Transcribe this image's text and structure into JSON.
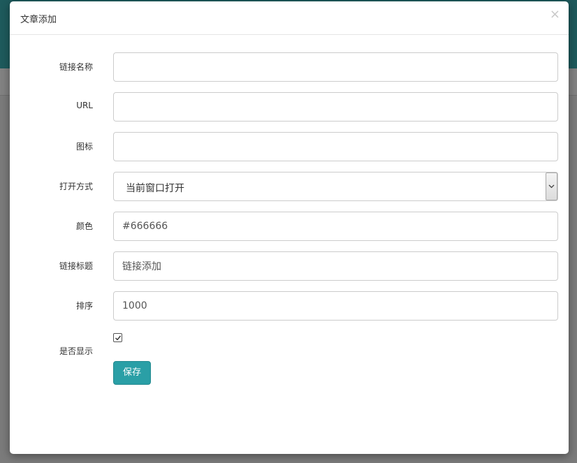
{
  "modal": {
    "title": "文章添加",
    "close_glyph": "×"
  },
  "form": {
    "link_name": {
      "label": "链接名称",
      "value": ""
    },
    "url": {
      "label": "URL",
      "value": ""
    },
    "icon": {
      "label": "图标",
      "value": ""
    },
    "open_mode": {
      "label": "打开方式",
      "selected": "当前窗口打开"
    },
    "color": {
      "label": "颜色",
      "value": "#666666"
    },
    "link_title": {
      "label": "链接标题",
      "value": "链接添加"
    },
    "sort": {
      "label": "排序",
      "value": "1000"
    },
    "show": {
      "label": "是否显示",
      "checked": true
    },
    "save_label": "保存"
  },
  "colors": {
    "accent": "#2a9fa6",
    "background_header": "#1e5a5c"
  },
  "icons": {
    "close": "close-icon",
    "dropdown": "chevron-down-icon",
    "check": "check-icon"
  }
}
